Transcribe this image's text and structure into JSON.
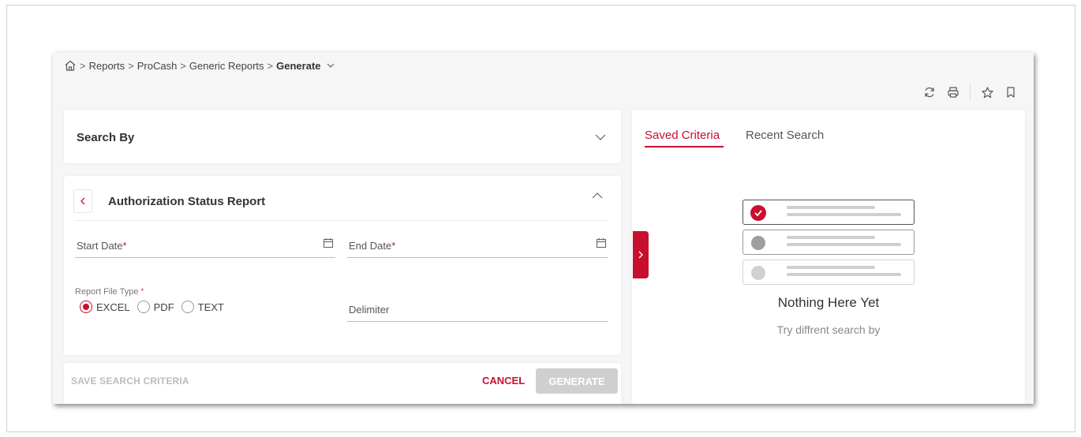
{
  "breadcrumb": {
    "items": [
      "Reports",
      "ProCash",
      "Generic Reports"
    ],
    "current": "Generate"
  },
  "search_by": {
    "title": "Search By"
  },
  "report": {
    "title": "Authorization Status Report",
    "start_date_label": "Start Date",
    "end_date_label": "End Date",
    "required_mark": "*",
    "file_type_label": "Report File Type",
    "file_types": [
      "EXCEL",
      "PDF",
      "TEXT"
    ],
    "selected_file_type": "EXCEL",
    "delimiter_label": "Delimiter"
  },
  "footer": {
    "save_criteria": "SAVE SEARCH CRITERIA",
    "cancel": "CANCEL",
    "generate": "GENERATE"
  },
  "right_panel": {
    "tabs": [
      "Saved Criteria",
      "Recent Search"
    ],
    "active_tab": "Saved Criteria",
    "empty_title": "Nothing Here Yet",
    "empty_subtitle": "Try diffrent search by"
  },
  "colors": {
    "accent": "#c8102e",
    "disabled_button": "#cfcfcf"
  },
  "icons": [
    "home-icon",
    "refresh-icon",
    "print-icon",
    "star-icon",
    "bookmark-icon",
    "calendar-icon",
    "chevron-down-icon",
    "chevron-up-icon",
    "chevron-left-icon",
    "chevron-right-icon",
    "check-icon"
  ]
}
